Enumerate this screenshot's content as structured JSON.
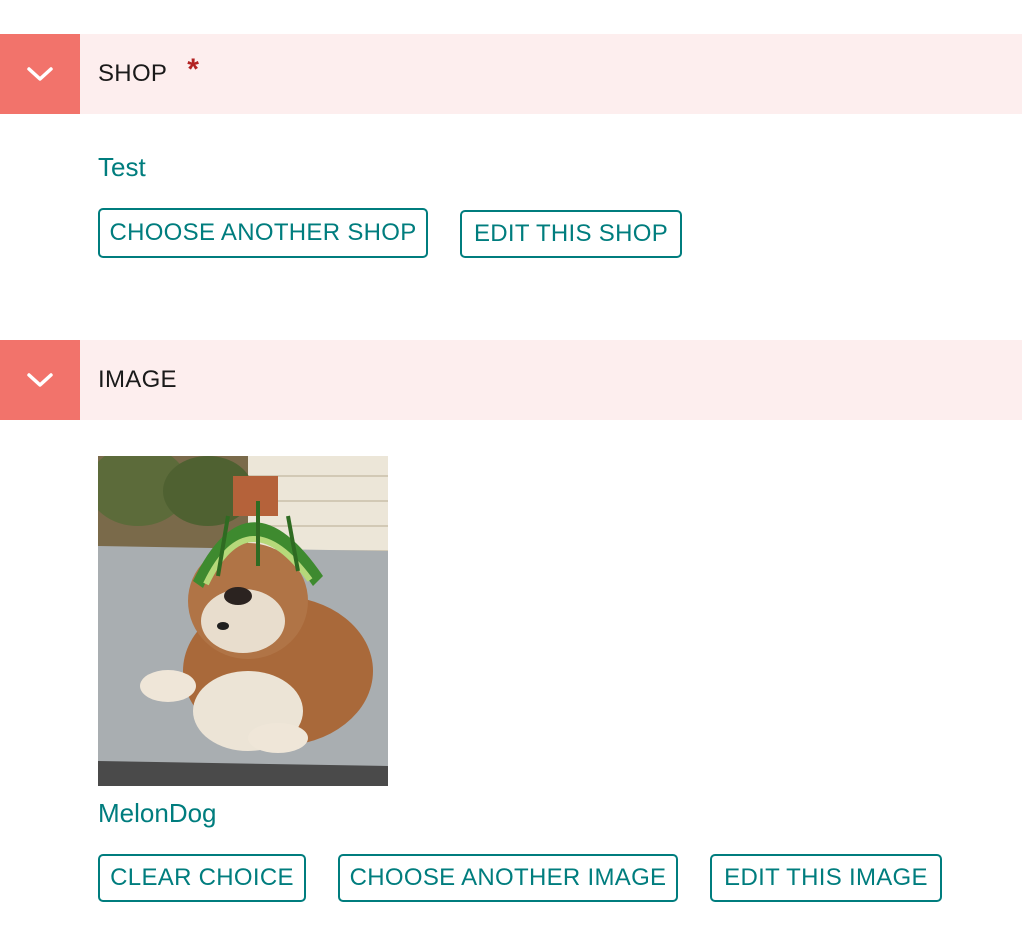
{
  "shop_panel": {
    "title": "SHOP",
    "required_mark": "*",
    "chosen_title": "Test",
    "buttons": {
      "choose_another": "CHOOSE ANOTHER SHOP",
      "edit": "EDIT THIS SHOP"
    }
  },
  "image_panel": {
    "title": "IMAGE",
    "chosen_title": "MelonDog",
    "buttons": {
      "clear": "CLEAR CHOICE",
      "choose_another": "CHOOSE ANOTHER IMAGE",
      "edit": "EDIT THIS IMAGE"
    }
  },
  "icons": {
    "toggle": "chevron-down-icon"
  },
  "colors": {
    "accent": "#007d7e",
    "toggle_bg": "#f2736b",
    "header_bg": "#fdeeee",
    "required": "#b22222"
  }
}
